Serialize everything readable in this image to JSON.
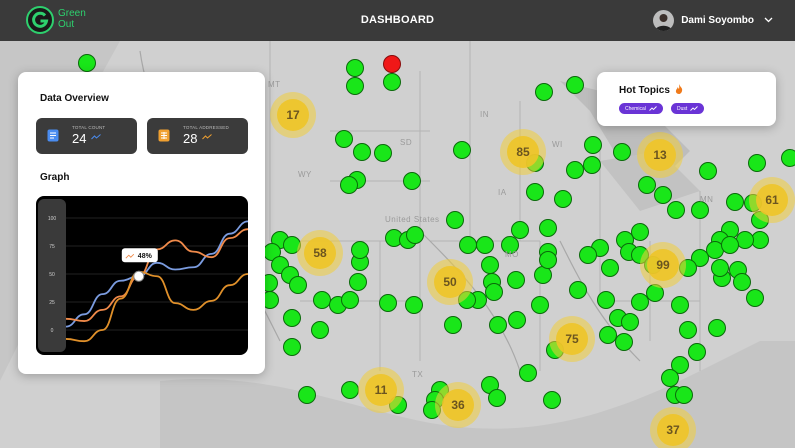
{
  "header": {
    "logo_line1": "Green",
    "logo_line2": "Out",
    "title": "DASHBOARD",
    "user_name": "Dami Soyombo",
    "accent_color": "#2ed06e"
  },
  "map": {
    "clusters": [
      "17",
      "85",
      "13",
      "61",
      "58",
      "50",
      "99",
      "75",
      "11",
      "36",
      "37"
    ],
    "places": [
      "MT",
      "SD",
      "MN",
      "WI",
      "IA",
      "MO",
      "TX",
      "WY",
      "United States",
      "IN"
    ]
  },
  "overview": {
    "title": "Data Overview",
    "stats": [
      {
        "label": "TOTAL COUNT",
        "value": "24",
        "icon": "document-icon",
        "icon_color": "#4a8cf0",
        "trend_color": "#4a8cf0"
      },
      {
        "label": "TOTAL ADDRESSED",
        "value": "28",
        "icon": "grid-icon",
        "icon_color": "#f0a030",
        "trend_color": "#f0a030"
      }
    ],
    "graph": {
      "title": "Graph",
      "tooltip": "48%"
    }
  },
  "chart_data": {
    "type": "line",
    "y_ticks": [
      "100",
      "75",
      "50",
      "25",
      "0"
    ],
    "ylim": [
      0,
      100
    ],
    "x": [
      0,
      1,
      2,
      3,
      4,
      5,
      6,
      7,
      8,
      9,
      10
    ],
    "series": [
      {
        "color": "#7b9ce0",
        "values": [
          3,
          14,
          32,
          44,
          48,
          60,
          54,
          56,
          68,
          86,
          97
        ]
      },
      {
        "color": "#f08a4a",
        "values": [
          10,
          8,
          18,
          30,
          48,
          72,
          80,
          70,
          65,
          82,
          90
        ]
      },
      {
        "color": "#e0902a",
        "values": [
          -8,
          -10,
          0,
          28,
          52,
          48,
          24,
          18,
          26,
          40,
          50
        ]
      }
    ],
    "highlight": {
      "x": 4,
      "y": 48
    }
  },
  "hot_topics": {
    "title": "Hot Topics",
    "tags": [
      "Chemical",
      "Dust"
    ],
    "tag_color": "#6a34d6"
  }
}
